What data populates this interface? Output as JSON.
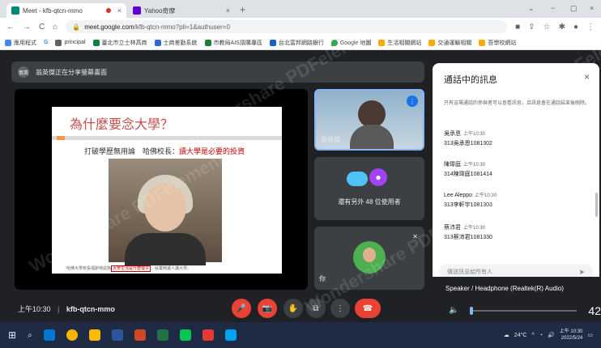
{
  "browser": {
    "tabs": [
      {
        "title": "Meet - kfb-qtcn-mmo",
        "close": "×"
      },
      {
        "title": "Yahoo奇摩",
        "close": "×"
      }
    ],
    "new_tab": "+",
    "window_controls": [
      "⌄",
      "−",
      "▢",
      "×"
    ],
    "nav": {
      "back": "←",
      "forward": "→",
      "reload": "C",
      "home": "⌂"
    },
    "url_host": "meet.google.com",
    "url_path": "/kfb-qtcn-mmo?pli=1&authuser=0",
    "bookmarks": [
      "應用程式",
      "G",
      "principal",
      "臺北市立士林高商",
      "士商差勤系統",
      "市教局AIS請購專區",
      "台北富邦網路銀行",
      "Google 地圖",
      "生活相關網站",
      "交通運輸相關",
      "吾學校網站"
    ]
  },
  "presenter_banner": {
    "avatar": "翁英",
    "text": "翁英傑正在分享螢幕畫面"
  },
  "slide": {
    "title": "為什麼要念大學？",
    "line_prefix": "打破學歷無用論　哈佛校長：",
    "line_highlight": "讀大學是必要的投資",
    "caption_pre": "哈佛大學校長福斯特認為",
    "caption_box": "大學生活是什麼樣子",
    "caption_post": "，就業時讓人讀大學。"
  },
  "tiles": {
    "speaker_name": "翁英傑",
    "others_label": "還有另外 48 位使用者",
    "self_label": "你"
  },
  "chat": {
    "title": "通話中的訊息",
    "close": "×",
    "notice": "只有這場通話的參與者可以查看訊息，且訊息會在通話結束後刪除。",
    "messages": [
      {
        "sender": "吳承恩",
        "time": "上午10:30",
        "text": "313吳承恩1081302"
      },
      {
        "sender": "陳瑋庭",
        "time": "上午10:30",
        "text": "314陳瑋庭1081414"
      },
      {
        "sender": "Lee Aleppo",
        "time": "上午10:30",
        "text": "313李軒宇1081303"
      },
      {
        "sender": "蔡沛君",
        "time": "上午10:30",
        "text": "313蔡沛君1081330"
      }
    ],
    "compose_placeholder": "傳送訊息給所有人",
    "send_icon": "➤"
  },
  "audio": {
    "device": "Speaker / Headphone (Realtek(R) Audio)",
    "volume": "42",
    "speaker_icon": "🔈"
  },
  "meeting_bar": {
    "time": "上午10:30",
    "separator": "|",
    "code": "kfb-qtcn-mmo"
  },
  "controls": {
    "mic": "🎤",
    "camera": "📷",
    "hand": "✋",
    "present": "⧉",
    "more": "⋮",
    "hangup": "☎"
  },
  "taskbar": {
    "weather": "24°C",
    "time": "上午 10:30",
    "date": "2022/5/24"
  },
  "watermark": "Wondershare PDFelement",
  "colors": {
    "accent": "#1a73e8",
    "hangup": "#ea4335",
    "highlight": "#c00000",
    "panel_bg": "#ffffff",
    "meet_bg": "#202124"
  }
}
